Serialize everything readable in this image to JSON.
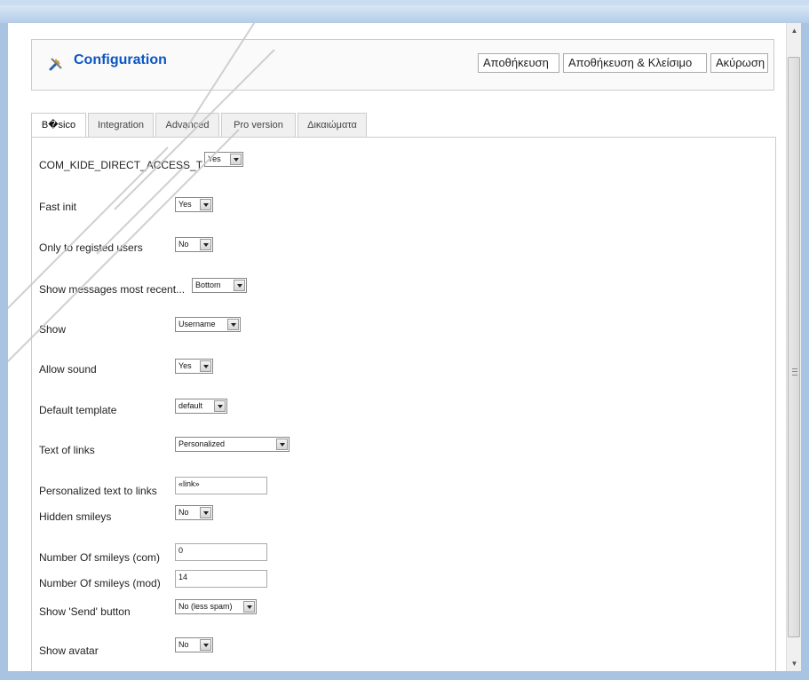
{
  "toolbar": {
    "title": "Configuration",
    "icon": "tools-icon",
    "buttons": {
      "save": "Αποθήκευση",
      "save_close": "Αποθήκευση & Κλείσιμο",
      "cancel": "Ακύρωση"
    }
  },
  "tabs": [
    "B�sico",
    "Integration",
    "Advanced",
    "Pro version",
    "Δικαιώματα"
  ],
  "fields": {
    "direct_access": {
      "label": "COM_KIDE_DIRECT_ACCESS_T",
      "value": "Yes"
    },
    "fast_init": {
      "label": "Fast init",
      "value": "Yes"
    },
    "only_registered": {
      "label": "Only to registed users",
      "value": "No"
    },
    "show_messages": {
      "label": "Show messages most recent...",
      "value": "Bottom"
    },
    "show": {
      "label": "Show",
      "value": "Username"
    },
    "allow_sound": {
      "label": "Allow sound",
      "value": "Yes"
    },
    "default_template": {
      "label": "Default template",
      "value": "default"
    },
    "text_of_links": {
      "label": "Text of links",
      "value": "Personalized"
    },
    "personalized_text": {
      "label": "Personalized text to links",
      "value": "«link»"
    },
    "hidden_smileys": {
      "label": "Hidden smileys",
      "value": "No"
    },
    "smileys_com": {
      "label": "Number Of smileys (com)",
      "value": "0"
    },
    "smileys_mod": {
      "label": "Number Of smileys (mod)",
      "value": "14"
    },
    "send_button": {
      "label": "Show 'Send' button",
      "value": "No (less spam)"
    },
    "show_avatar": {
      "label": "Show avatar",
      "value": "No"
    }
  },
  "colors": {
    "accent": "#0b55c4",
    "frame": "#a9c4e2",
    "watermark": "#c8c8c8"
  }
}
